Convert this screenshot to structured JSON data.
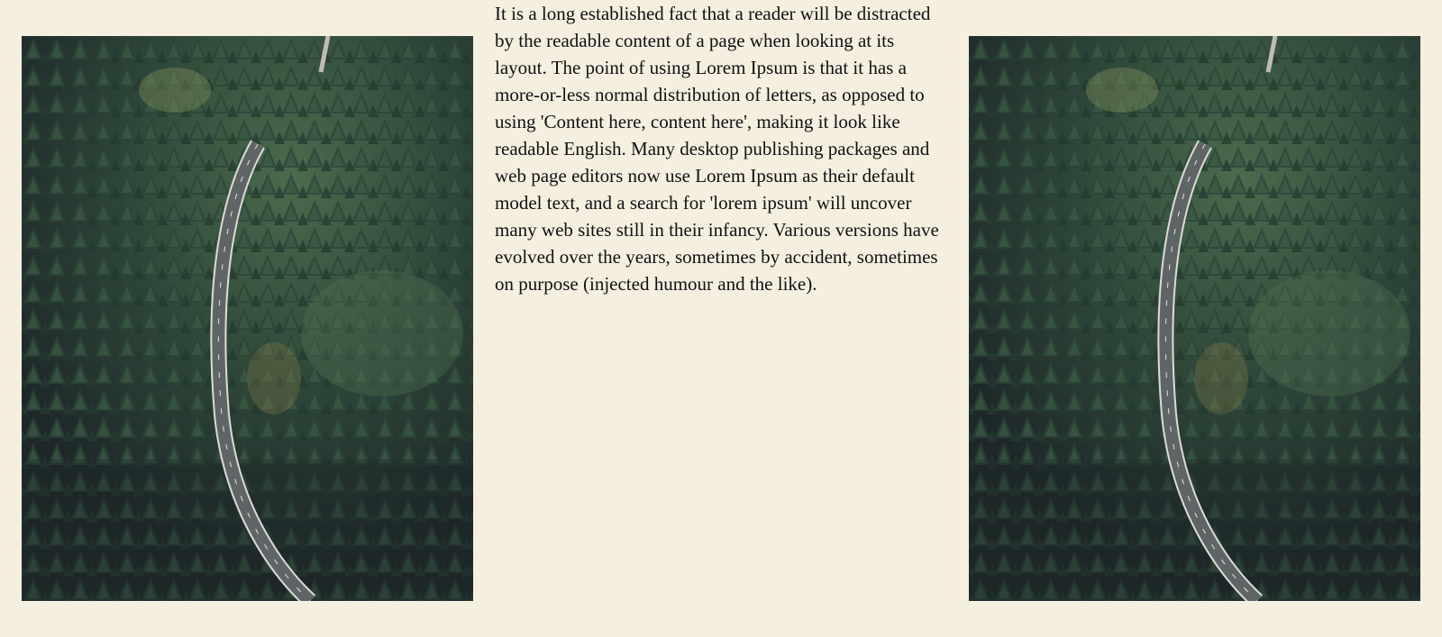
{
  "page": {
    "background": "#f5efe0"
  },
  "images": [
    {
      "name": "forest-road-photo-left",
      "depicts": "aerial view of a winding road through a dense pine forest",
      "colors": {
        "trees": "#2f4a3c",
        "shadow": "#1f2a2b",
        "road": "#6d7274",
        "road_edge": "#dcdcd6",
        "highlight": "#9aa56a"
      }
    },
    {
      "name": "forest-road-photo-right",
      "depicts": "aerial view of a winding road through a dense pine forest",
      "colors": {
        "trees": "#2f4a3c",
        "shadow": "#1f2a2b",
        "road": "#6d7274",
        "road_edge": "#dcdcd6",
        "highlight": "#9aa56a"
      }
    }
  ],
  "article": {
    "text": "It is a long established fact that a reader will be distracted by the readable content of a page when looking at its layout. The point of using Lorem Ipsum is that it has a more-or-less normal distribution of letters, as opposed to using 'Content here, content here', making it look like readable English. Many desktop publishing packages and web page editors now use Lorem Ipsum as their default model text, and a search for 'lorem ipsum' will uncover many web sites still in their infancy. Various versions have evolved over the years, sometimes by accident, sometimes on purpose (injected humour and the like)."
  }
}
